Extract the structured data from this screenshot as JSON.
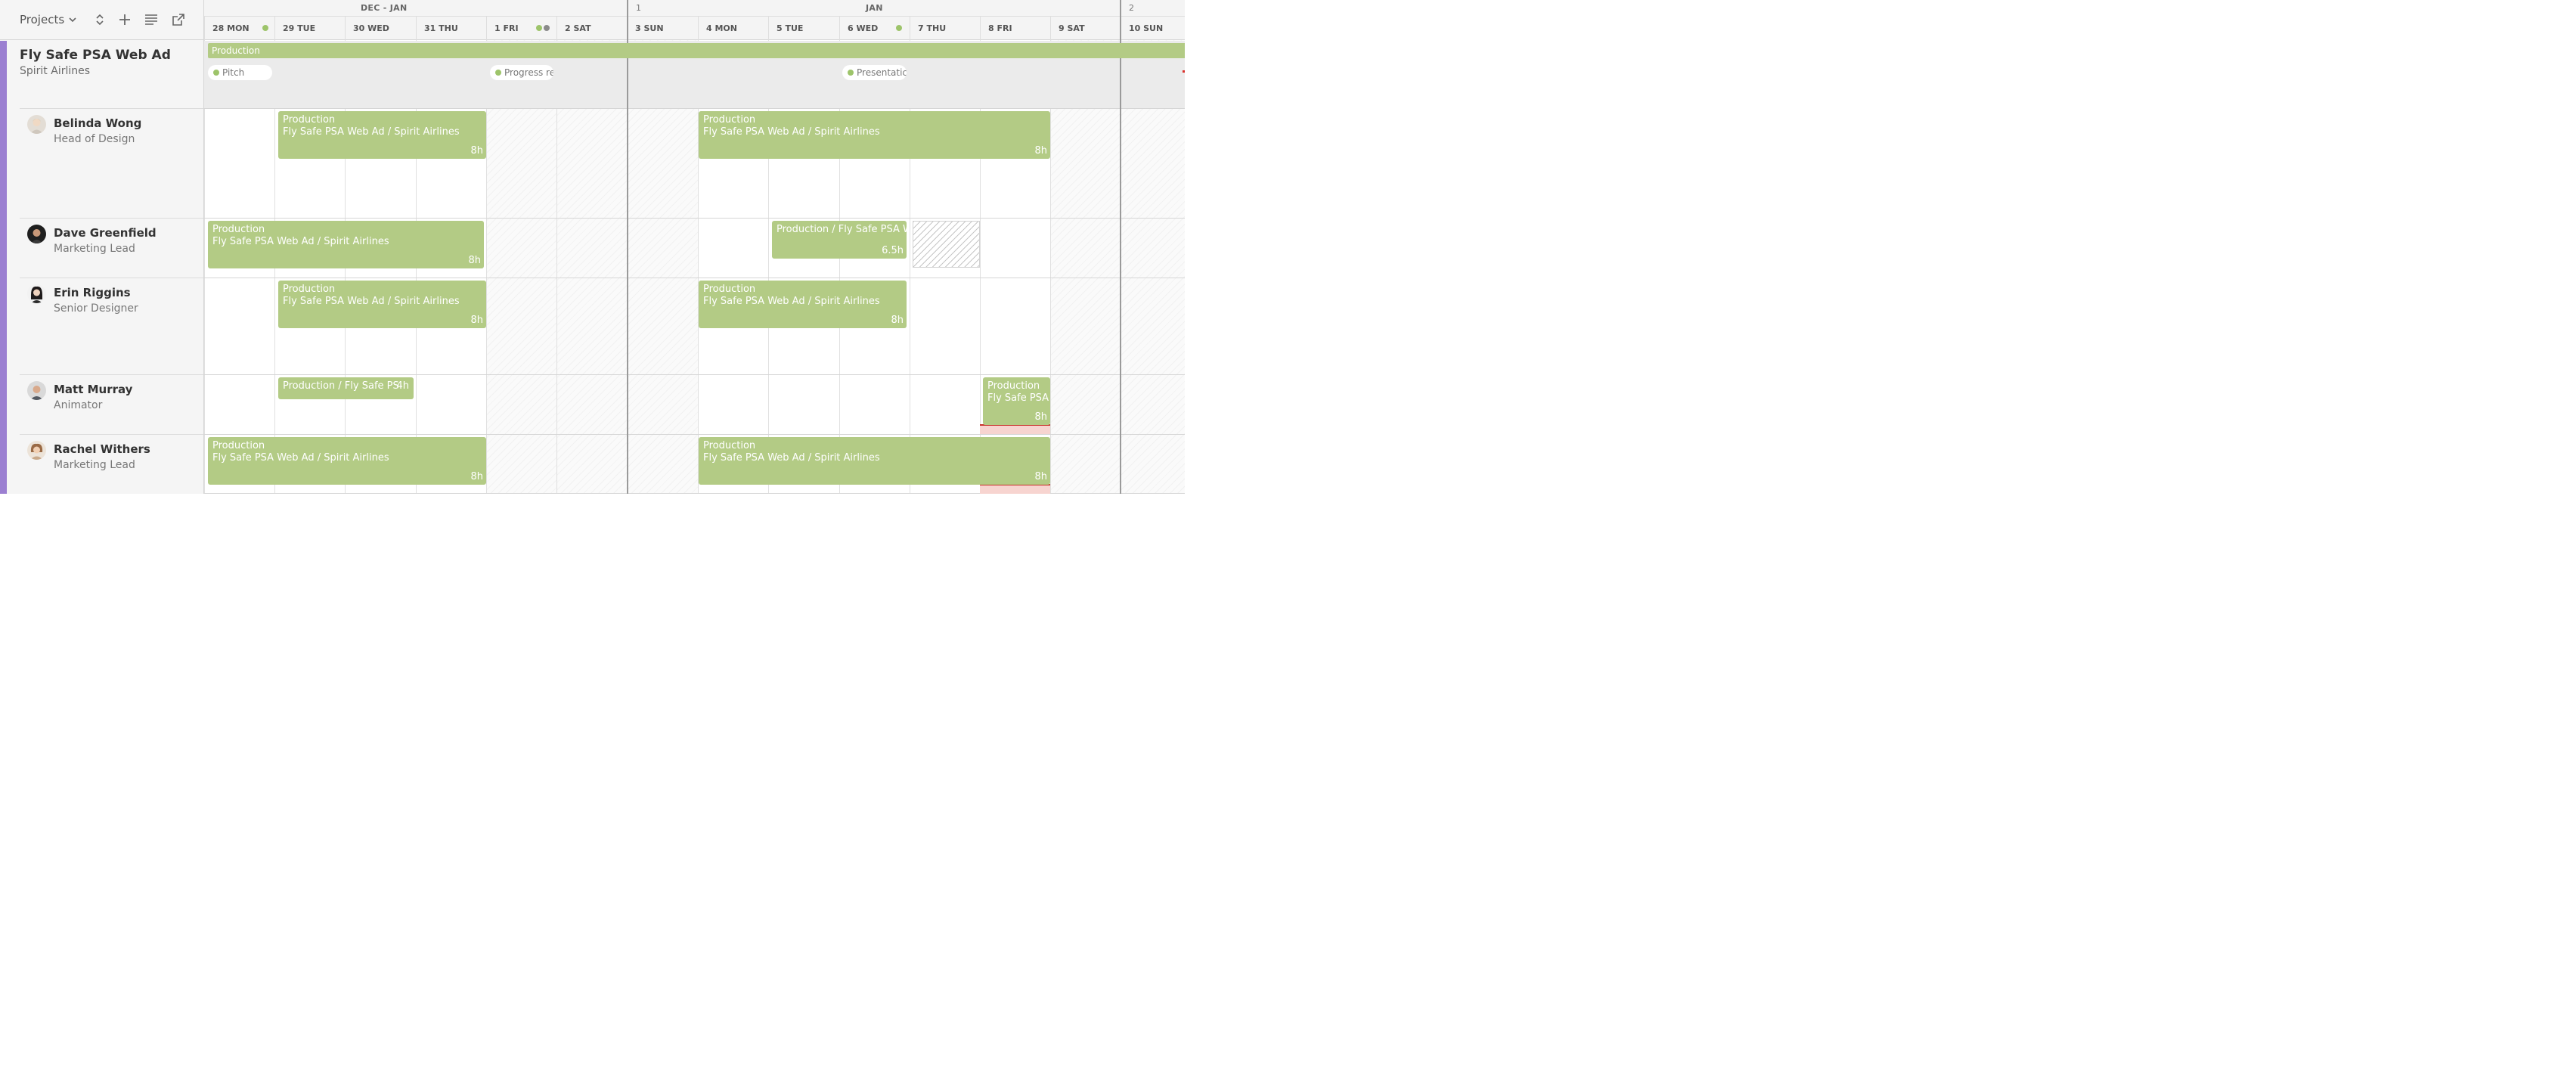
{
  "toolbar": {
    "view_label": "Projects",
    "icons": [
      "chevron-down-icon",
      "expand-collapse-icon",
      "plus-icon",
      "list-icon",
      "external-link-icon"
    ]
  },
  "project": {
    "name": "Fly Safe PSA Web Ad",
    "client": "Spirit Airlines",
    "phase": "Production",
    "milestones": [
      "Pitch",
      "Progress re",
      "Presentatic"
    ]
  },
  "calendar": {
    "month_labels": [
      "DEC - JAN",
      "JAN"
    ],
    "week_numbers": [
      "1",
      "2"
    ],
    "days": [
      {
        "label": "28 MON",
        "weekend": false
      },
      {
        "label": "29 TUE",
        "weekend": false
      },
      {
        "label": "30 WED",
        "weekend": false
      },
      {
        "label": "31 THU",
        "weekend": false
      },
      {
        "label": "1 FRI",
        "weekend": true
      },
      {
        "label": "2 SAT",
        "weekend": true
      },
      {
        "label": "3 SUN",
        "weekend": true
      },
      {
        "label": "4 MON",
        "weekend": false
      },
      {
        "label": "5 TUE",
        "weekend": false
      },
      {
        "label": "6 WED",
        "weekend": false
      },
      {
        "label": "7 THU",
        "weekend": false
      },
      {
        "label": "8 FRI",
        "weekend": false
      },
      {
        "label": "9 SAT",
        "weekend": true
      },
      {
        "label": "10 SUN",
        "weekend": true
      }
    ],
    "header_dot_colors": [
      "#9dc46a",
      "#8a8a8a"
    ]
  },
  "people": [
    {
      "name": "Belinda Wong",
      "role": "Head of Design"
    },
    {
      "name": "Dave Greenfield",
      "role": "Marketing Lead"
    },
    {
      "name": "Erin Riggins",
      "role": "Senior Designer"
    },
    {
      "name": "Matt Murray",
      "role": "Animator"
    },
    {
      "name": "Rachel Withers",
      "role": "Marketing Lead"
    }
  ],
  "allocations": {
    "phase": "Production",
    "subtitle": "Fly Safe PSA Web Ad / Spirit Airlines",
    "inline_short": "Production / Fly Safe PS",
    "inline_medium": "Production / Fly Safe PSA W",
    "subtitle_short": "Fly Safe PSA",
    "hours_8": "8h",
    "hours_6_5": "6.5h",
    "hours_4": "4h"
  },
  "colors": {
    "accent": "#9b7fd1",
    "allocation": "#b3cb85",
    "overload": "#c8322b"
  }
}
